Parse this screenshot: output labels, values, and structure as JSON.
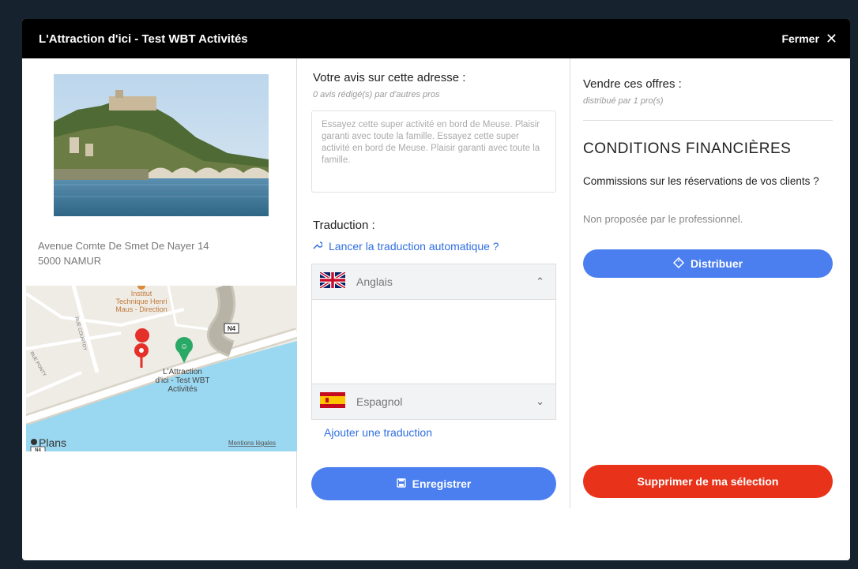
{
  "header": {
    "title": "L'Attraction d'ici - Test WBT Activités",
    "close_label": "Fermer"
  },
  "left": {
    "address_line1": "Avenue Comte De Smet De Nayer 14",
    "address_line2": "5000 NAMUR",
    "map": {
      "poi_label_1": "Institut",
      "poi_label_2": "Technique Henri",
      "poi_label_3": "Maus - Direction",
      "road_badge": "N4",
      "street_1": "RUE COURTOY",
      "street_2": "RUE PONTY",
      "place_label_1": "L'Attraction",
      "place_label_2": "d'ici - Test WBT",
      "place_label_3": "Activités",
      "brand": "Plans",
      "legal": "Mentions légales",
      "road_badge_2": "N4"
    }
  },
  "middle": {
    "avis_title": "Votre avis sur cette adresse :",
    "avis_sub": "0 avis rédigé(s) par d'autres pros",
    "avis_text": "Essayez cette super activité en bord de Meuse. Plaisir garanti  avec toute la famille. Essayez cette super activité en bord de Meuse. Plaisir garanti  avec toute la famille.",
    "traduction_title": "Traduction :",
    "auto_translate": "Lancer la traduction automatique ?",
    "lang_1": "Anglais",
    "lang_2": "Espagnol",
    "add_translation": "Ajouter une traduction",
    "save_label": "Enregistrer"
  },
  "right": {
    "vendre_title": "Vendre ces offres :",
    "vendre_sub": "distribué par 1 pro(s)",
    "conditions_title": "CONDITIONS FINANCIÈRES",
    "commission_q": "Commissions sur les réservations de vos clients ?",
    "non_propose": "Non proposée par le professionnel.",
    "distribute_label": "Distribuer",
    "delete_label": "Supprimer de ma sélection"
  },
  "colors": {
    "primary": "#4b7ff0",
    "danger": "#e8321a",
    "link": "#2f6fe0",
    "header": "#000000"
  }
}
